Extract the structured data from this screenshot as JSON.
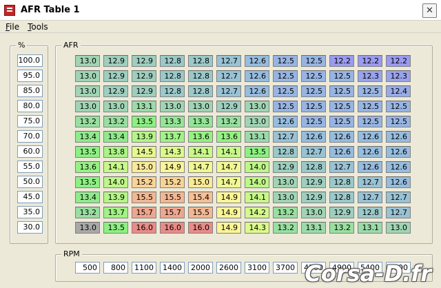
{
  "window": {
    "title": "AFR Table 1",
    "close_glyph": "✕"
  },
  "menu": [
    {
      "mnemonic": "F",
      "rest": "ile"
    },
    {
      "mnemonic": "T",
      "rest": "ools"
    }
  ],
  "pct_group": {
    "label": "%"
  },
  "afr_group": {
    "label": "AFR"
  },
  "rpm_group": {
    "label": "RPM"
  },
  "pct_values": [
    "100.0",
    "95.0",
    "85.0",
    "80.0",
    "75.0",
    "70.0",
    "60.0",
    "55.0",
    "50.0",
    "45.0",
    "35.0",
    "30.0"
  ],
  "rpm_values": [
    "500",
    "800",
    "1100",
    "1400",
    "2000",
    "2600",
    "3100",
    "3700",
    "4300",
    "4900",
    "5400",
    "6000"
  ],
  "afr_rows": [
    [
      "13.0",
      "12.9",
      "12.9",
      "12.8",
      "12.8",
      "12.7",
      "12.6",
      "12.5",
      "12.5",
      "12.2",
      "12.2",
      "12.2"
    ],
    [
      "13.0",
      "12.9",
      "12.9",
      "12.8",
      "12.8",
      "12.7",
      "12.6",
      "12.5",
      "12.5",
      "12.5",
      "12.3",
      "12.3"
    ],
    [
      "13.0",
      "12.9",
      "12.9",
      "12.8",
      "12.8",
      "12.7",
      "12.6",
      "12.5",
      "12.5",
      "12.5",
      "12.5",
      "12.4"
    ],
    [
      "13.0",
      "13.0",
      "13.1",
      "13.0",
      "13.0",
      "12.9",
      "13.0",
      "12.5",
      "12.5",
      "12.5",
      "12.5",
      "12.5"
    ],
    [
      "13.2",
      "13.2",
      "13.5",
      "13.3",
      "13.3",
      "13.2",
      "13.0",
      "12.6",
      "12.5",
      "12.5",
      "12.5",
      "12.5"
    ],
    [
      "13.4",
      "13.4",
      "13.9",
      "13.7",
      "13.6",
      "13.6",
      "13.1",
      "12.7",
      "12.6",
      "12.6",
      "12.6",
      "12.6"
    ],
    [
      "13.5",
      "13.8",
      "14.5",
      "14.3",
      "14.1",
      "14.1",
      "13.5",
      "12.8",
      "12.7",
      "12.6",
      "12.6",
      "12.6"
    ],
    [
      "13.6",
      "14.1",
      "15.0",
      "14.9",
      "14.7",
      "14.7",
      "14.0",
      "12.9",
      "12.8",
      "12.7",
      "12.6",
      "12.6"
    ],
    [
      "13.5",
      "14.0",
      "15.2",
      "15.2",
      "15.0",
      "14.7",
      "14.0",
      "13.0",
      "12.9",
      "12.8",
      "12.7",
      "12.6"
    ],
    [
      "13.4",
      "13.9",
      "15.5",
      "15.5",
      "15.4",
      "14.9",
      "14.1",
      "13.0",
      "12.9",
      "12.8",
      "12.7",
      "12.7"
    ],
    [
      "13.2",
      "13.7",
      "15.7",
      "15.7",
      "15.5",
      "14.9",
      "14.2",
      "13.2",
      "13.0",
      "12.9",
      "12.8",
      "12.7"
    ],
    [
      "13.0",
      "13.5",
      "16.0",
      "16.0",
      "16.0",
      "14.9",
      "14.3",
      "13.2",
      "13.1",
      "13.2",
      "13.1",
      "13.0"
    ]
  ],
  "watermark": {
    "text": "Corsa-D.fr"
  },
  "colors": {
    "selected_cell": "#a8a8a8",
    "scale_lean_high": "#e08a88",
    "scale_rich_low": "#9a9af0"
  }
}
